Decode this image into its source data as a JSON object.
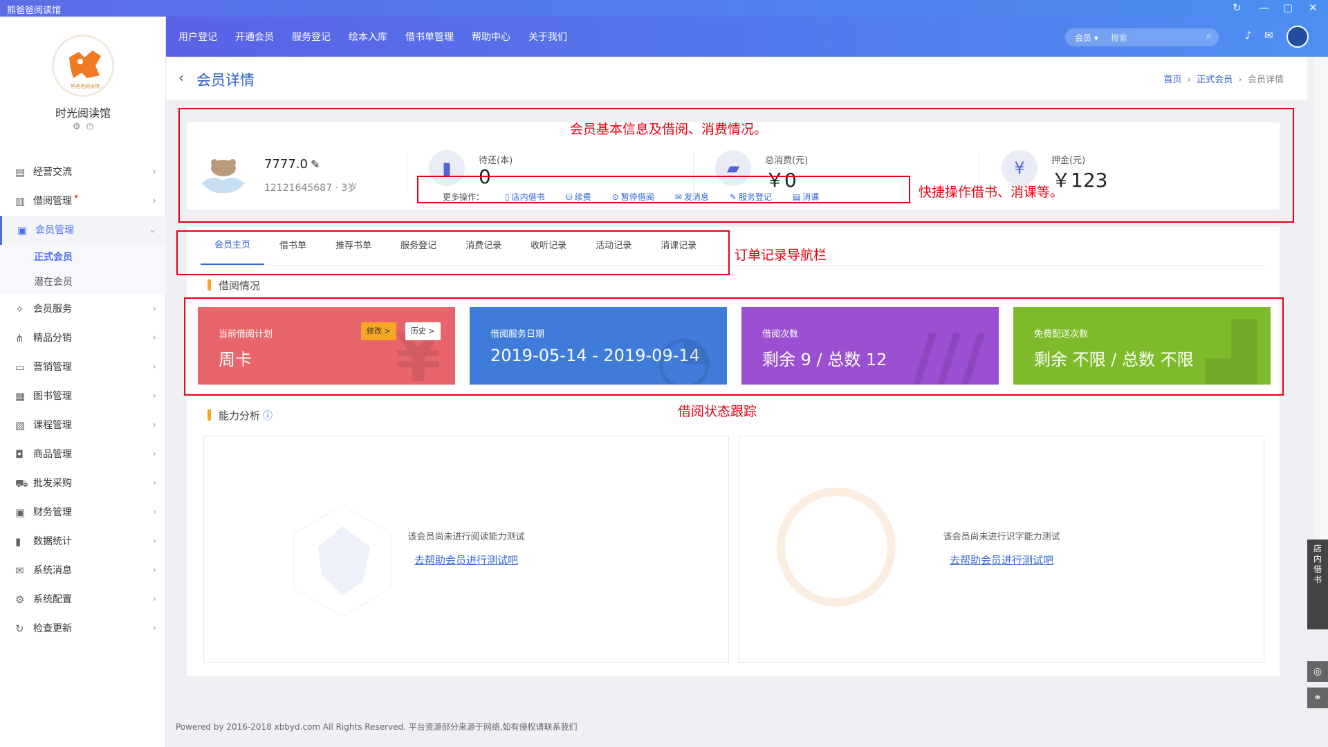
{
  "app": {
    "title": "熊爸爸阅读馆"
  },
  "sidebar": {
    "logo_text": "熊爸爸阅读馆",
    "shop": "时光阅读馆",
    "items": [
      {
        "label": "经营交流",
        "icon": "chat-icon"
      },
      {
        "label": "借阅管理",
        "icon": "book-icon"
      },
      {
        "label": "会员管理",
        "icon": "user-card-icon"
      },
      {
        "label": "会员服务",
        "icon": "service-icon"
      },
      {
        "label": "精品分销",
        "icon": "sitemap-icon"
      },
      {
        "label": "营销管理",
        "icon": "ticket-icon"
      },
      {
        "label": "图书管理",
        "icon": "image-icon"
      },
      {
        "label": "课程管理",
        "icon": "course-icon"
      },
      {
        "label": "商品管理",
        "icon": "bag-icon"
      },
      {
        "label": "批发采购",
        "icon": "cart-icon"
      },
      {
        "label": "财务管理",
        "icon": "finance-icon"
      },
      {
        "label": "数据统计",
        "icon": "bar-chart-icon"
      },
      {
        "label": "系统消息",
        "icon": "mail-icon"
      },
      {
        "label": "系统配置",
        "icon": "gear-icon"
      },
      {
        "label": "检查更新",
        "icon": "refresh-icon"
      }
    ],
    "sub_items": [
      {
        "label": "正式会员"
      },
      {
        "label": "潜在会员"
      }
    ]
  },
  "topnav": {
    "items": [
      "用户登记",
      "开通会员",
      "服务登记",
      "绘本入库",
      "借书单管理",
      "帮助中心",
      "关于我们"
    ],
    "search_category": "会员",
    "search_placeholder": "搜索"
  },
  "page": {
    "title": "会员详情",
    "breadcrumb": [
      "首页",
      "正式会员",
      "会员详情"
    ]
  },
  "member": {
    "name": "7777.0",
    "phone_age": "12121645687 · 3岁",
    "stats": [
      {
        "label": "待还(本)",
        "value": "0",
        "icon": "book-icon"
      },
      {
        "label": "总消费(元)",
        "value": "￥0",
        "icon": "wallet-icon"
      },
      {
        "label": "押金(元)",
        "value": "￥123",
        "icon": "yen-shield-icon"
      }
    ],
    "ops_label": "更多操作：",
    "ops": [
      "店内借书",
      "续费",
      "暂停借阅",
      "发消息",
      "服务登记",
      "消课"
    ]
  },
  "tabs": [
    "会员主页",
    "借书单",
    "推荐书单",
    "服务登记",
    "消费记录",
    "收听记录",
    "活动记录",
    "消课记录"
  ],
  "borrow": {
    "section": "借阅情况",
    "cards": [
      {
        "label": "当前借阅计划",
        "value": "周卡",
        "color": "#e8666b",
        "deco": "¥",
        "edit": "修改 >",
        "history": "历史 >"
      },
      {
        "label": "借阅服务日期",
        "value": "2019-05-14 - 2019-09-14",
        "color": "#3f7bd8",
        "deco": "◔"
      },
      {
        "label": "借阅次数",
        "value": "剩余 9 / 总数 12",
        "color": "#9b4fd1",
        "deco": "///"
      },
      {
        "label": "免费配送次数",
        "value": "剩余 不限 / 总数 不限",
        "color": "#7dbb2a",
        "deco": "▟"
      }
    ]
  },
  "ability": {
    "section": "能力分析",
    "reading": {
      "msg": "该会员尚未进行阅读能力测试",
      "link": "去帮助会员进行测试吧"
    },
    "literacy": {
      "msg": "该会员尚未进行识字能力测试",
      "link": "去帮助会员进行测试吧"
    }
  },
  "footer": "Powered by 2016-2018 xbbyd.com All Rights Reserved. 平台资源部分来源于网络,如有侵权请联系我们",
  "annotations": [
    "会员基本信息及借阅、消费情况。",
    "快捷操作借书、消课等。",
    "订单记录导航栏",
    "借阅状态跟踪"
  ],
  "float_bar": "店内借书",
  "colors": {
    "accent": "#3066d8",
    "topbar_start": "#5a62e6",
    "topbar_end": "#4d8ff2",
    "annotation": "#e60012"
  }
}
